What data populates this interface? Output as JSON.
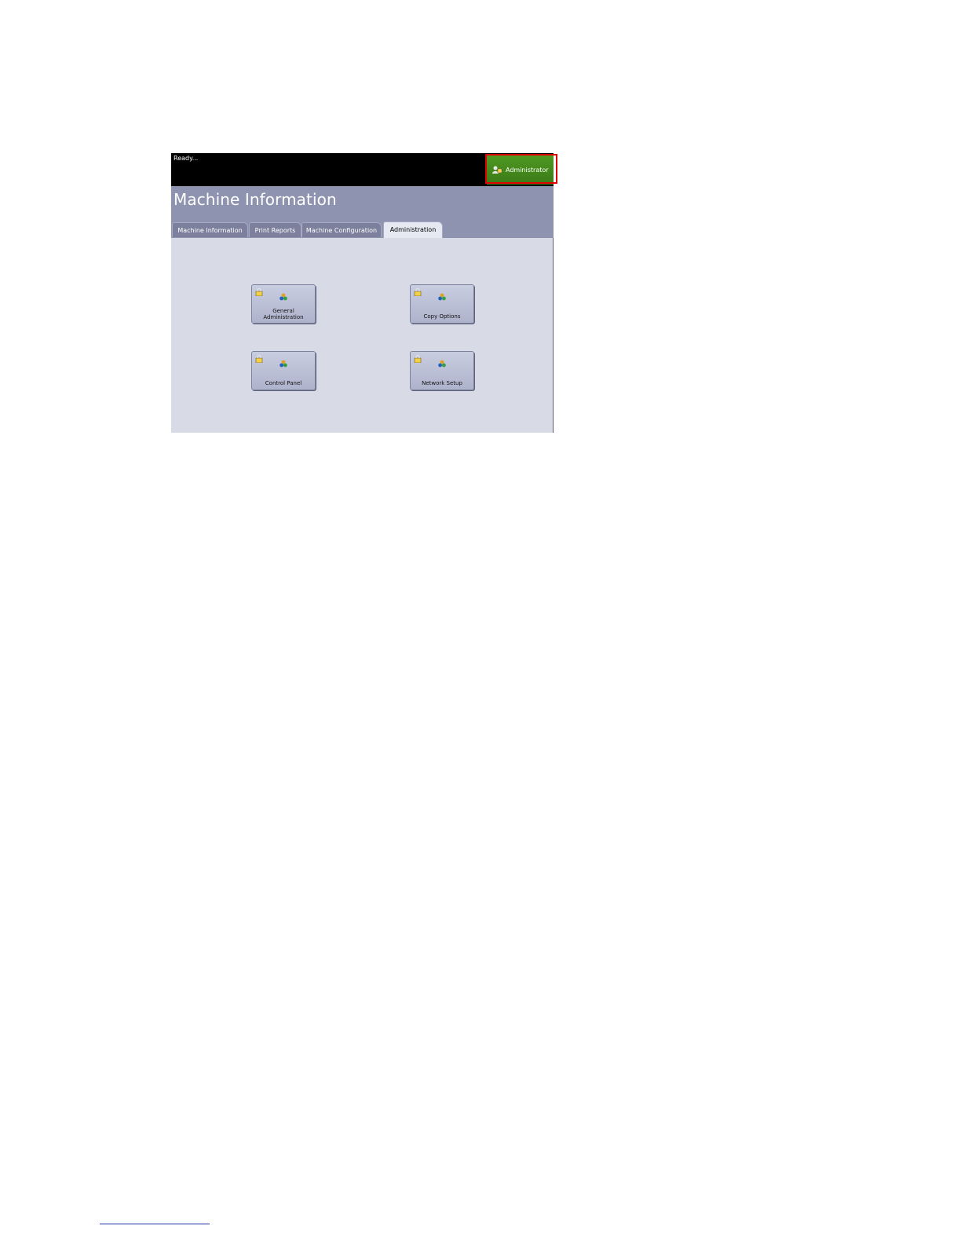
{
  "status_bar": {
    "status_text": "Ready...",
    "user_button_label": "Administrator",
    "user_icon": "user-icon"
  },
  "header": {
    "title": "Machine Information"
  },
  "tabs": [
    {
      "label": "Machine Information",
      "active": false
    },
    {
      "label": "Print Reports",
      "active": false
    },
    {
      "label": "Machine Configuration",
      "active": false
    },
    {
      "label": "Administration",
      "active": true
    }
  ],
  "features": [
    {
      "label": "General\nAdministration",
      "icon": "settings-icon",
      "lock_icon": "lock-icon"
    },
    {
      "label": "Copy Options",
      "icon": "settings-icon",
      "lock_icon": "lock-icon"
    },
    {
      "label": "Control Panel",
      "icon": "settings-icon",
      "lock_icon": "lock-icon"
    },
    {
      "label": "Network Setup",
      "icon": "settings-icon",
      "lock_icon": "lock-icon"
    }
  ],
  "colors": {
    "status_bar": "#000000",
    "admin_button": "#4a8f1f",
    "header": "#8e93b0",
    "content": "#d8dae6",
    "highlight": "#e00000"
  }
}
